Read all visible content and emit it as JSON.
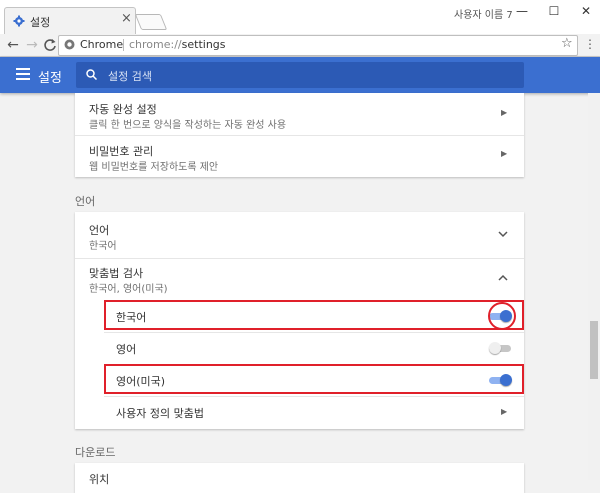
{
  "tab": {
    "title": "설정",
    "close": "×",
    "icon": "gear-icon"
  },
  "window": {
    "user": "사용자 이름 7",
    "minimize": "—",
    "maximize": "☐",
    "close": "✕"
  },
  "toolbar": {
    "back": "←",
    "forward": "→",
    "reload": "C"
  },
  "omnibox": {
    "site_label": "Chrome",
    "url_scheme": "chrome://",
    "url_path": "settings"
  },
  "header": {
    "title": "설정",
    "search_placeholder": "설정 검색",
    "accent": "#3b6fd0"
  },
  "autofill": {
    "title": "자동 완성 설정",
    "desc": "클릭 한 번으로 양식을 작성하는 자동 완성 사용"
  },
  "passwords": {
    "title": "비밀번호 관리",
    "desc": "웹 비밀번호를 저장하도록 제안"
  },
  "language_section": {
    "heading": "언어"
  },
  "language": {
    "title": "언어",
    "value": "한국어"
  },
  "spellcheck": {
    "title": "맞춤법 검사",
    "value": "한국어, 영어(미국)",
    "items": [
      {
        "label": "한국어",
        "enabled": true
      },
      {
        "label": "영어",
        "enabled": false
      },
      {
        "label": "영어(미국)",
        "enabled": true
      }
    ],
    "custom_label": "사용자 정의 맞춤법"
  },
  "download_section": {
    "heading": "다운로드"
  },
  "download": {
    "partial": "위치"
  }
}
